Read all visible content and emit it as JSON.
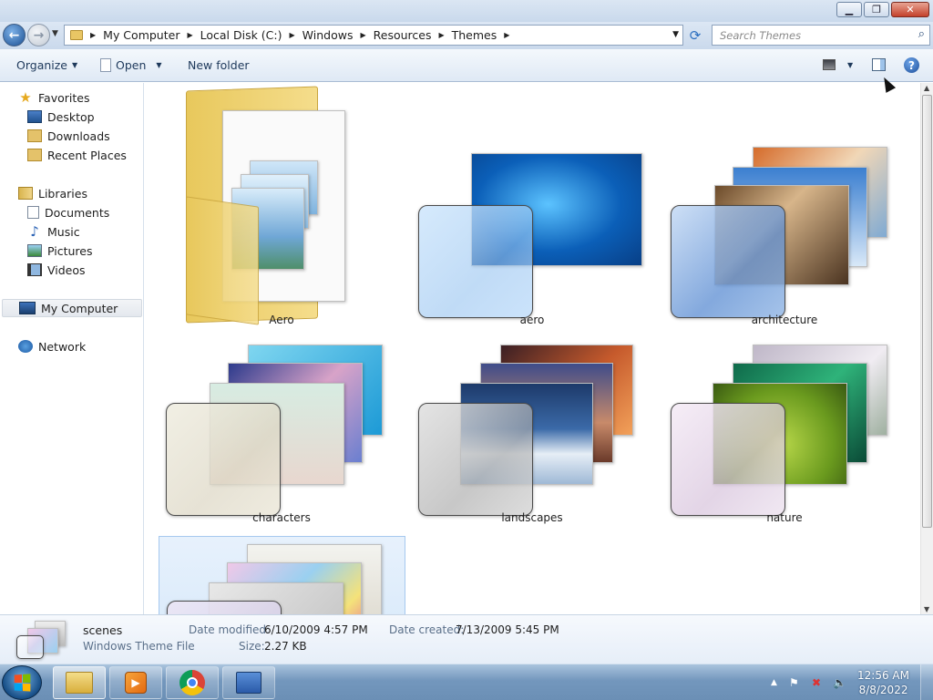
{
  "window": {
    "minimize_icon": "minimize-icon",
    "maximize_icon": "restore-icon",
    "close_icon": "close-icon"
  },
  "address": {
    "breadcrumbs": [
      "My Computer",
      "Local Disk (C:)",
      "Windows",
      "Resources",
      "Themes"
    ],
    "search_placeholder": "Search Themes"
  },
  "toolbar": {
    "organize": "Organize",
    "open": "Open",
    "new_folder": "New folder"
  },
  "sidebar": {
    "favorites": {
      "label": "Favorites",
      "items": [
        "Desktop",
        "Downloads",
        "Recent Places"
      ]
    },
    "libraries": {
      "label": "Libraries",
      "items": [
        "Documents",
        "Music",
        "Pictures",
        "Videos"
      ]
    },
    "computer": "My Computer",
    "network": "Network"
  },
  "items": [
    {
      "label": "Aero",
      "type": "folder"
    },
    {
      "label": "aero",
      "type": "theme"
    },
    {
      "label": "architecture",
      "type": "theme"
    },
    {
      "label": "characters",
      "type": "theme"
    },
    {
      "label": "landscapes",
      "type": "theme"
    },
    {
      "label": "nature",
      "type": "theme"
    },
    {
      "label": "",
      "type": "theme",
      "selected": true
    }
  ],
  "details": {
    "name": "scenes",
    "file_type": "Windows Theme File",
    "modified_label": "Date modified:",
    "modified_value": "6/10/2009 4:57 PM",
    "created_label": "Date created:",
    "created_value": "7/13/2009 5:45 PM",
    "size_label": "Size:",
    "size_value": "2.27 KB"
  },
  "taskbar": {
    "time": "12:56 AM",
    "date": "8/8/2022"
  },
  "colors": {
    "accent": "#3a7bd5",
    "selection": "#d8e9fa",
    "taskbar": "#6b8fb5"
  }
}
